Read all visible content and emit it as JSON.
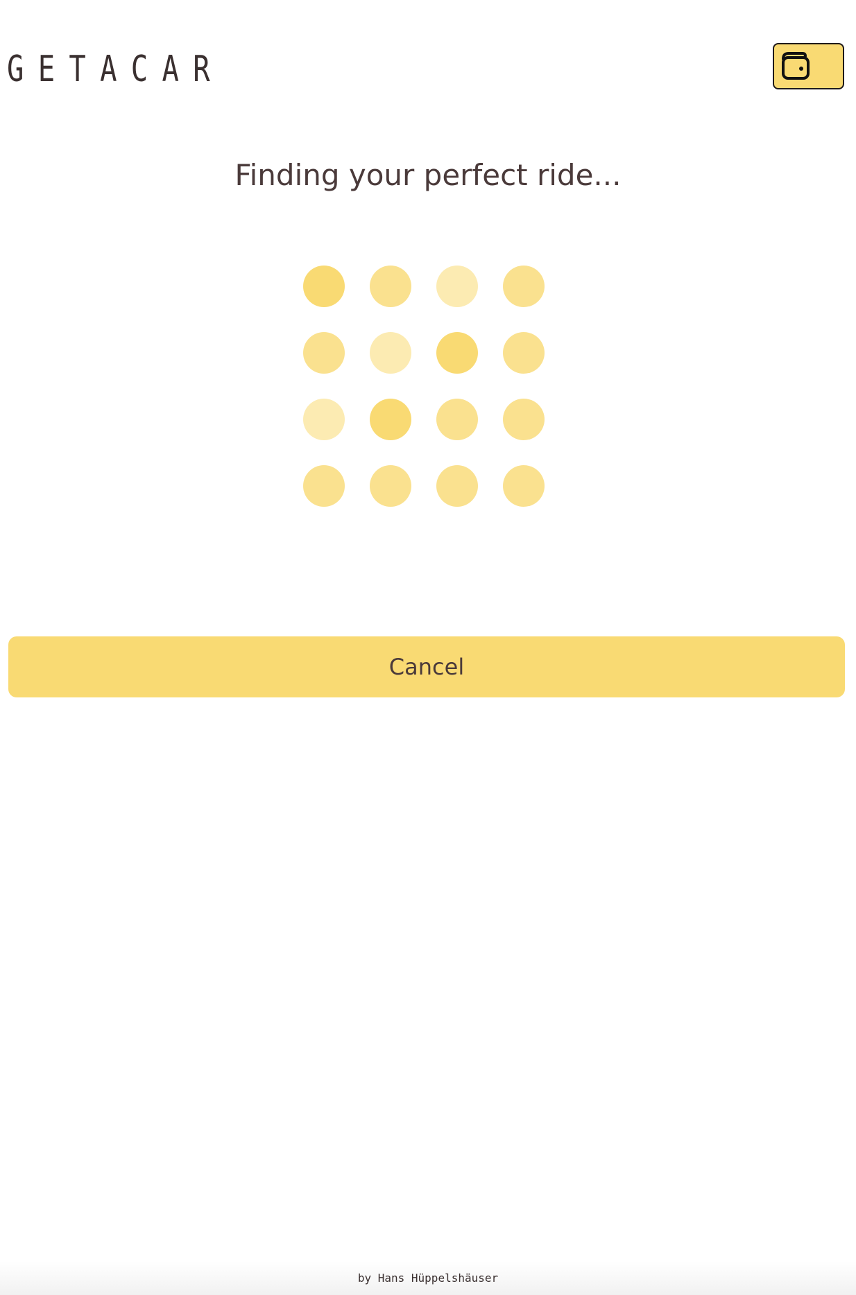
{
  "app": {
    "logo_text": "GETACAR"
  },
  "header": {
    "wallet_icon": "wallet-icon"
  },
  "main": {
    "title": "Finding your perfect ride...",
    "loader": {
      "rows": 4,
      "cols": 4,
      "dot_opacities": [
        [
          1.0,
          0.8,
          0.55,
          0.8
        ],
        [
          0.8,
          0.55,
          1.0,
          0.8
        ],
        [
          0.55,
          1.0,
          0.8,
          0.8
        ],
        [
          0.8,
          0.8,
          0.8,
          0.8
        ]
      ]
    },
    "cancel_label": "Cancel"
  },
  "footer": {
    "credit": "by Hans Hüppelshäuser"
  },
  "colors": {
    "accent": "#f9da73",
    "text": "#4a3a3a",
    "border": "#1f1a1a"
  }
}
